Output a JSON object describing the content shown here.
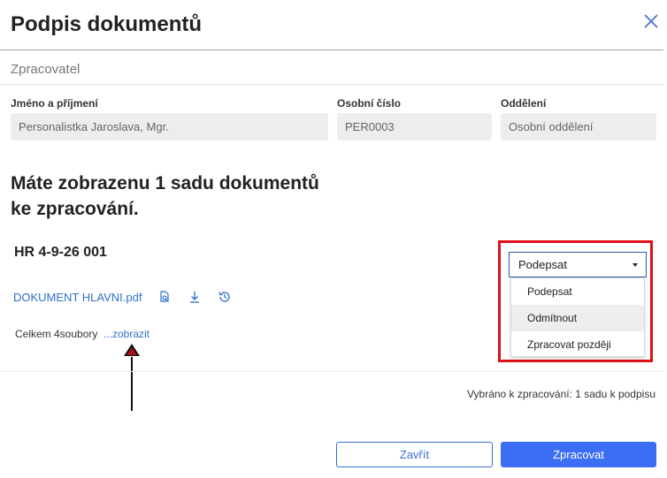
{
  "dialog": {
    "title": "Podpis dokumentů"
  },
  "processor": {
    "section_label": "Zpracovatel",
    "fields": [
      {
        "label": "Jméno a příjmení",
        "value": "Personalistka Jaroslava, Mgr."
      },
      {
        "label": "Osobní číslo",
        "value": "PER0003"
      },
      {
        "label": "Oddělení",
        "value": "Osobní oddělení"
      }
    ]
  },
  "main": {
    "heading_line1": "Máte zobrazenu 1 sadu dokumentů",
    "heading_line2": "ke zpracování."
  },
  "document_set": {
    "title": "HR 4-9-26 001",
    "file_link": "DOKUMENT HLAVNI.pdf",
    "total_label": "Celkem 4soubory",
    "show_link": "...zobrazit",
    "icons": [
      "document-search-icon",
      "download-icon",
      "history-icon"
    ]
  },
  "action_select": {
    "selected": "Podepsat",
    "options": [
      "Podepsat",
      "Odmítnout",
      "Zpracovat později"
    ],
    "highlighted_option": "Odmítnout"
  },
  "summary": {
    "text": "Vybráno k zpracování: 1 sadu k podpisu"
  },
  "footer": {
    "close_label": "Zavřít",
    "process_label": "Zpracovat"
  },
  "colors": {
    "accent": "#3b6ef3",
    "link": "#2f6fc7",
    "annotation_frame": "#e0101a"
  }
}
